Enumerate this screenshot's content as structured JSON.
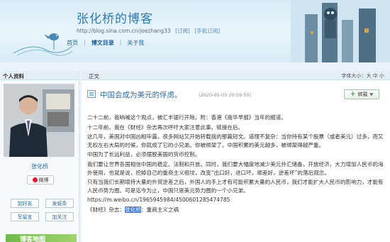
{
  "header": {
    "title": "张化桥的博客",
    "url": "http://blog.sina.com.cn/joezhang33",
    "subscribe": "[订阅]",
    "mobile_subscribe": "[手机订阅]",
    "nav": [
      "首页",
      "博文目录",
      "关于我"
    ],
    "nav_sep": "|"
  },
  "sidebar": {
    "header": "个人资料",
    "name": "张化桥",
    "weibo": "微博",
    "buttons": [
      "加好友",
      "发纸条",
      "写留言",
      "加关注"
    ],
    "ad": "博客地图"
  },
  "main": {
    "header": "正文",
    "font_size_label": "字体大小：大 中 小",
    "post_title": "中国会成为美元的俘虏。",
    "post_time": "(2020-05-03 20:59:50)",
    "share_label": "转载",
    "paragraphs": [
      "二十二前，我呐喊这个观点，被汇丰银行开除。附：香港《南华早报》当年的报道。",
      "十二年前，我在《财经》杂志再次呼吁大家注意此事。链接在后。",
      "这几年，美国对中国凶相毕露。很多网站又开始转载我的那篇短文。道理不复杂：当你持有某个股票（或者美元）过多，而又无权左右大局的时候，你就成了它的小兄弟。你被绑架了。中国积累的美元越多，被绑架得越严重。",
      "中国为了长远利益，必须摆脱美国的货币控制。",
      "我们要让世界各国相信中国的稳定、法制和开放。同时，我们要大幅度地减少美元外汇储备，开放经济，大力增加人民币的海外使用，也就是说，挖掉自己的重商主义祖坟，改变“出口好，进口坏，顺差好，逆差坏”的落后观念。",
      "只有当我们长期增持大量的外贸逆差之后，外国人的手上才有可能积累大量的人民币，我们才能扩大人民币的影响力，才能有人民币势力圈。可是迄今为止，中国只是美元势力圈的一个小兄弟。",
      "https://m.weibo.cn/1965945984/4500601285474785"
    ],
    "last_line": {
      "prefix": "《财经》杂志：",
      "highlight": "张化桥",
      "suffix": "：重商主义之祸"
    }
  },
  "colors": {
    "accent": "#2f79b6",
    "header_bg": "#d9ecf6",
    "highlight": "#3d7be0"
  },
  "icons": [
    "weibo-icon",
    "title-doc-icon",
    "plus-icon"
  ]
}
